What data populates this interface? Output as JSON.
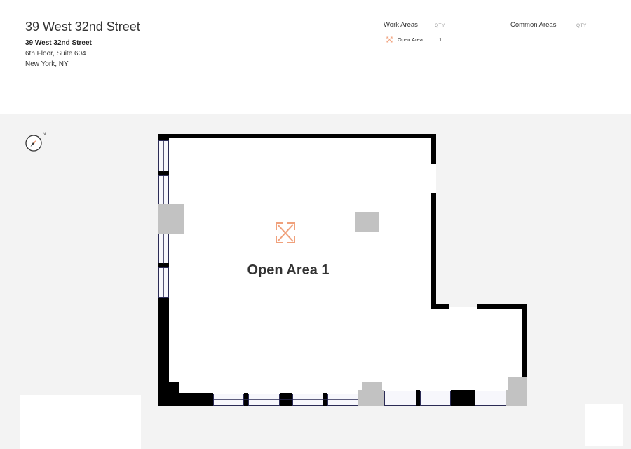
{
  "header": {
    "title": "39 West 32nd Street",
    "address_name": "39 West 32nd Street",
    "address_line1": "6th Floor, Suite 604",
    "address_line2": "New York, NY"
  },
  "legend": {
    "work_areas_label": "Work Areas",
    "work_qty_label": "QTY",
    "common_areas_label": "Common Areas",
    "common_qty_label": "QTY",
    "work_items": [
      {
        "icon": "open-area-icon",
        "label": "Open Area",
        "qty": "1"
      }
    ]
  },
  "floorplan": {
    "room_label": "Open Area 1",
    "compass_north": "N",
    "accent_color": "#f0a17c"
  }
}
